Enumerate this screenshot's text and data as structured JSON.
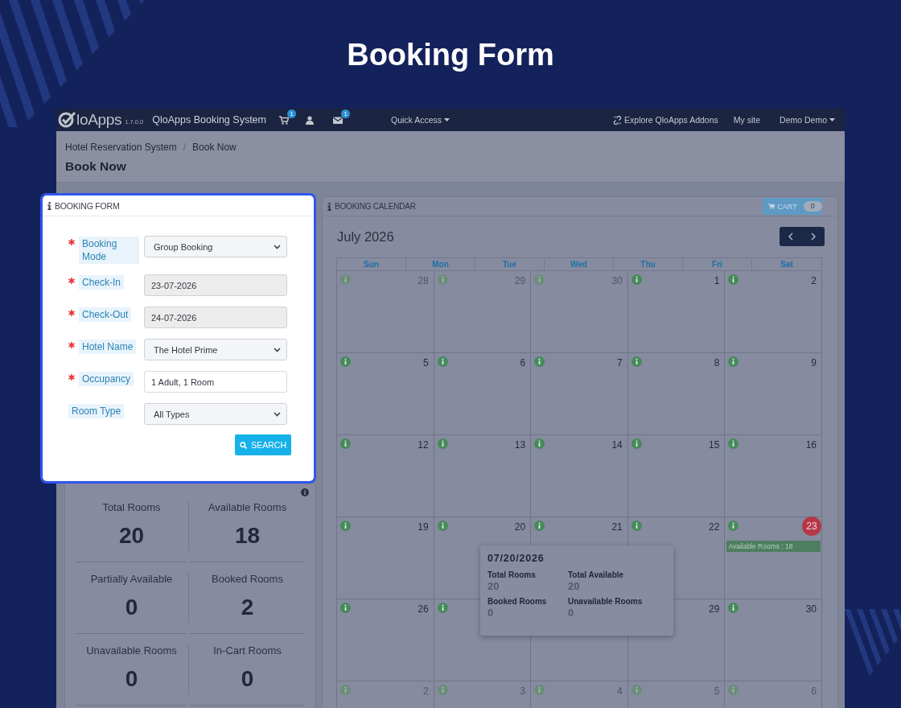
{
  "page_title": "Booking Form",
  "navbar": {
    "logo_text": "loApps",
    "version": "1.7.0.0",
    "app_name": "QloApps Booking System",
    "cart_badge": "1",
    "messages_badge": "1",
    "quick_access": "Quick Access",
    "addons_link": "Explore QloApps Addons",
    "my_site": "My site",
    "user_menu": "Demo Demo"
  },
  "breadcrumb": {
    "items": [
      "Hotel Reservation System",
      "Book Now"
    ],
    "separator": "/"
  },
  "page_heading": "Book Now",
  "booking_form": {
    "title": "BOOKING FORM",
    "fields": [
      {
        "label": "Booking Mode",
        "required": true,
        "kind": "select",
        "value": "Group Booking"
      },
      {
        "label": "Check-In",
        "required": true,
        "kind": "date",
        "value": "23-07-2026"
      },
      {
        "label": "Check-Out",
        "required": true,
        "kind": "date",
        "value": "24-07-2026"
      },
      {
        "label": "Hotel Name",
        "required": true,
        "kind": "select",
        "value": "The Hotel Prime"
      },
      {
        "label": "Occupancy",
        "required": true,
        "kind": "text",
        "value": "1 Adult, 1 Room"
      },
      {
        "label": "Room Type",
        "required": false,
        "kind": "select",
        "value": "All Types"
      }
    ],
    "search_button": "SEARCH"
  },
  "stats": [
    {
      "label": "Total Rooms",
      "value": "20"
    },
    {
      "label": "Available Rooms",
      "value": "18"
    },
    {
      "label": "Partially Available",
      "value": "0"
    },
    {
      "label": "Booked Rooms",
      "value": "2"
    },
    {
      "label": "Unavailable Rooms",
      "value": "0"
    },
    {
      "label": "In-Cart Rooms",
      "value": "0"
    }
  ],
  "calendar": {
    "title": "BOOKING CALENDAR",
    "cart_label": "CART",
    "cart_count": "0",
    "month": "July 2026",
    "weekdays": [
      "Sun",
      "Mon",
      "Tue",
      "Wed",
      "Thu",
      "Fri",
      "Sat"
    ],
    "weeks": [
      [
        {
          "day": "28",
          "muted": true,
          "selected": false,
          "info": true
        },
        {
          "day": "29",
          "muted": true,
          "selected": false,
          "info": true
        },
        {
          "day": "30",
          "muted": true,
          "selected": false,
          "info": true
        },
        {
          "day": "1",
          "muted": false,
          "selected": false,
          "info": true
        },
        {
          "day": "2",
          "muted": false,
          "selected": false,
          "info": true
        }
      ],
      [
        {
          "day": "5",
          "muted": false,
          "selected": false,
          "info": true
        },
        {
          "day": "6",
          "muted": false,
          "selected": false,
          "info": true
        },
        {
          "day": "7",
          "muted": false,
          "selected": false,
          "info": true
        },
        {
          "day": "8",
          "muted": false,
          "selected": false,
          "info": true
        },
        {
          "day": "9",
          "muted": false,
          "selected": false,
          "info": true
        }
      ],
      [
        {
          "day": "12",
          "muted": false,
          "selected": false,
          "info": true
        },
        {
          "day": "13",
          "muted": false,
          "selected": false,
          "info": true
        },
        {
          "day": "14",
          "muted": false,
          "selected": false,
          "info": true
        },
        {
          "day": "15",
          "muted": false,
          "selected": false,
          "info": true
        },
        {
          "day": "16",
          "muted": false,
          "selected": false,
          "info": true
        }
      ],
      [
        {
          "day": "19",
          "muted": false,
          "selected": false,
          "info": true
        },
        {
          "day": "20",
          "muted": false,
          "selected": false,
          "info": true
        },
        {
          "day": "21",
          "muted": false,
          "selected": false,
          "info": true
        },
        {
          "day": "22",
          "muted": false,
          "selected": false,
          "info": true
        },
        {
          "day": "23",
          "muted": false,
          "selected": true,
          "info": true,
          "badge": "Available Rooms : 18"
        }
      ],
      [
        {
          "day": "26",
          "muted": false,
          "selected": false,
          "info": true
        },
        {
          "info": true
        },
        {
          "info": false
        },
        {
          "day": "29",
          "muted": false,
          "selected": false,
          "info": false
        },
        {
          "day": "30",
          "muted": false,
          "selected": false,
          "info": true
        }
      ],
      [
        {
          "day": "2",
          "muted": true,
          "selected": false,
          "info": true
        },
        {
          "day": "3",
          "muted": true,
          "selected": false,
          "info": true
        },
        {
          "day": "4",
          "muted": true,
          "selected": false,
          "info": true
        },
        {
          "day": "5",
          "muted": true,
          "selected": false,
          "info": true
        },
        {
          "day": "6",
          "muted": true,
          "selected": false,
          "info": true
        }
      ]
    ],
    "tooltip": {
      "date": "07/20/2026",
      "items": [
        {
          "label": "Total Rooms",
          "value": "20"
        },
        {
          "label": "Total Available",
          "value": "20"
        },
        {
          "label": "Booked Rooms",
          "value": "0"
        },
        {
          "label": "Unavailable Rooms",
          "value": "0"
        }
      ]
    }
  }
}
